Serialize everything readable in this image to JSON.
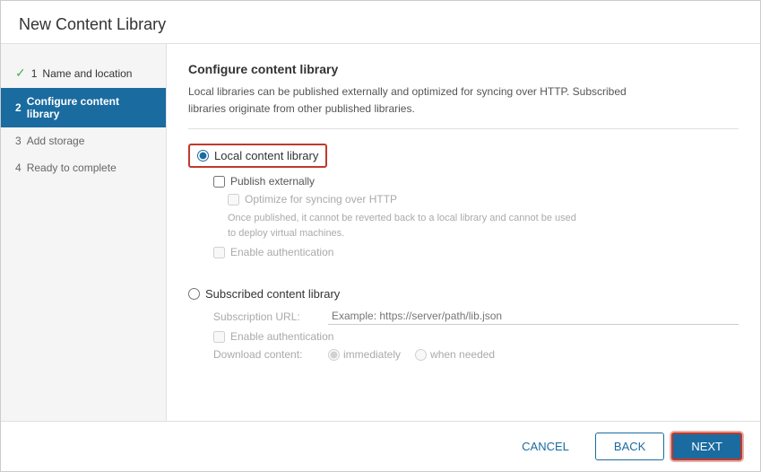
{
  "dialog": {
    "title": "New Content Library"
  },
  "sidebar": {
    "steps": [
      {
        "id": "step-1",
        "number": "1",
        "label": "Name and location",
        "state": "completed"
      },
      {
        "id": "step-2",
        "number": "2",
        "label": "Configure content library",
        "state": "active"
      },
      {
        "id": "step-3",
        "number": "3",
        "label": "Add storage",
        "state": "default"
      },
      {
        "id": "step-4",
        "number": "4",
        "label": "Ready to complete",
        "state": "default"
      }
    ]
  },
  "main": {
    "section_title": "Configure content library",
    "description_line1": "Local libraries can be published externally and optimized for syncing over HTTP. Subscribed",
    "description_line2": "libraries originate from other published libraries.",
    "local_radio_label": "Local content library",
    "publish_externally_label": "Publish externally",
    "optimize_http_label": "Optimize for syncing over HTTP",
    "optimize_note": "Once published, it cannot be reverted back to a local library and cannot be used\nto deploy virtual machines.",
    "enable_auth_local_label": "Enable authentication",
    "subscribed_radio_label": "Subscribed content library",
    "subscription_url_label": "Subscription URL:",
    "subscription_url_placeholder": "Example: https://server/path/lib.json",
    "enable_auth_sub_label": "Enable authentication",
    "download_content_label": "Download content:",
    "immediately_label": "immediately",
    "when_needed_label": "when needed"
  },
  "footer": {
    "cancel_label": "CANCEL",
    "back_label": "BACK",
    "next_label": "NEXT"
  }
}
